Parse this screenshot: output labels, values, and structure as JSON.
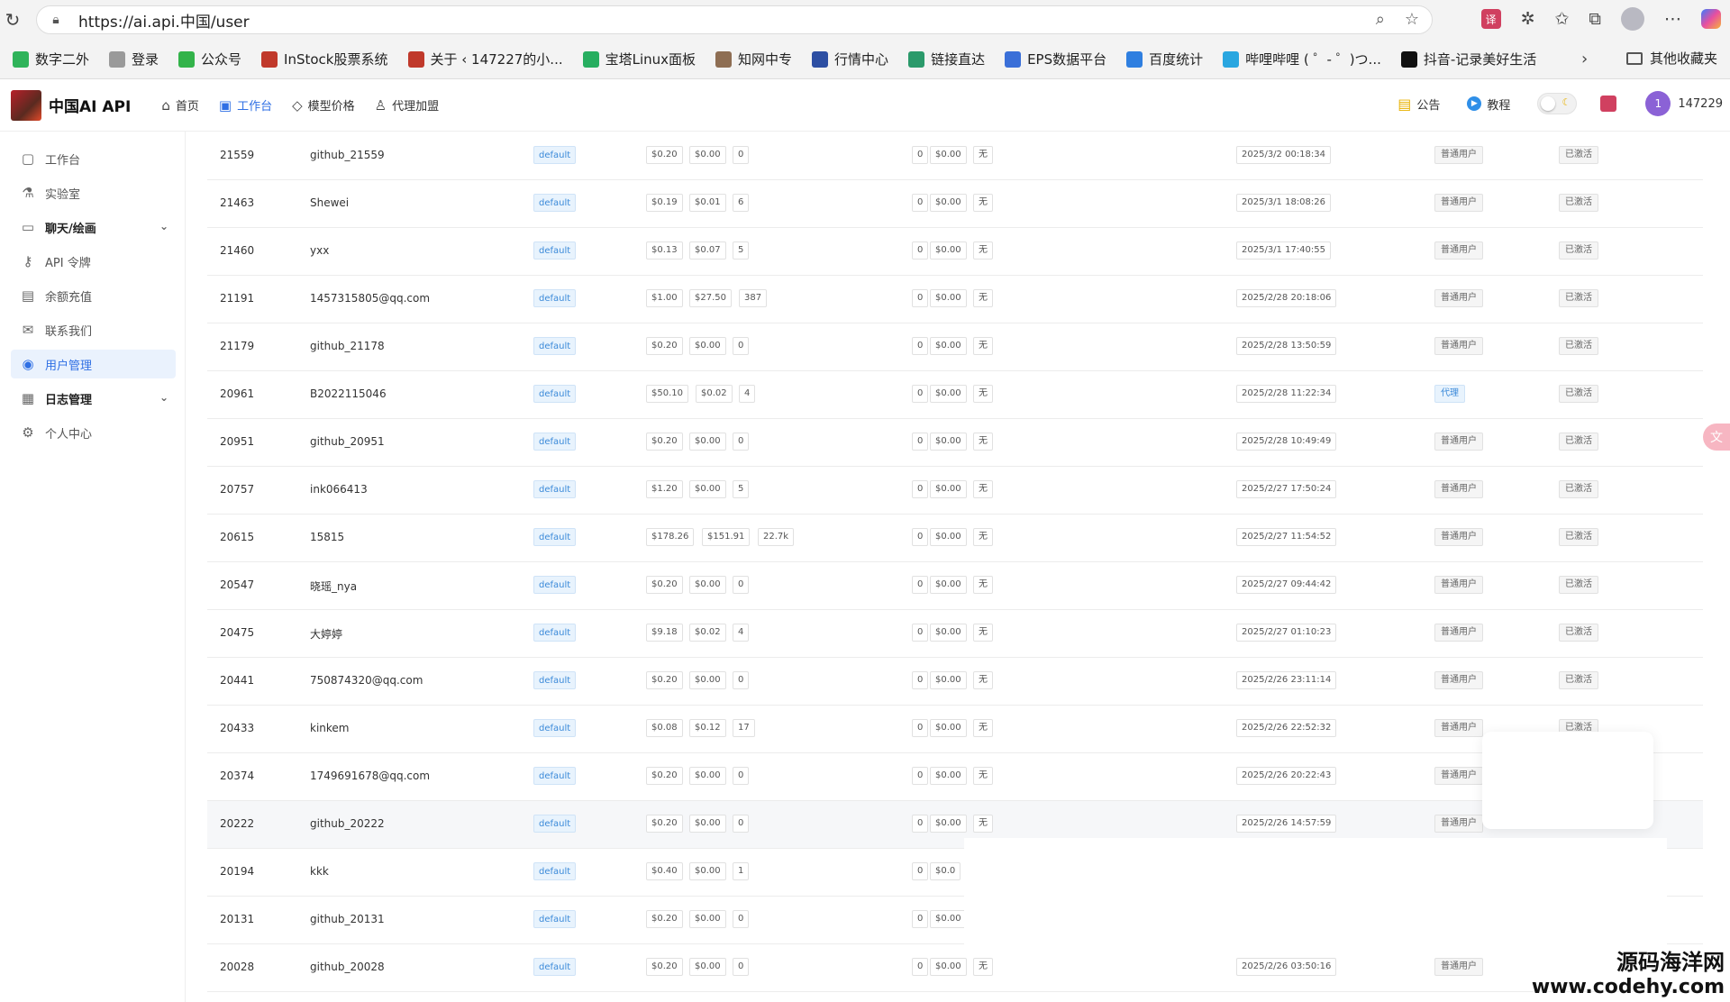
{
  "browser": {
    "url": "https://ai.api.中国/user",
    "bookmarks": [
      {
        "label": "数字二外",
        "color": "#2fb35a"
      },
      {
        "label": "登录",
        "color": "#9a9a9a"
      },
      {
        "label": "公众号",
        "color": "#33b34a"
      },
      {
        "label": "InStock股票系统",
        "color": "#c0392b"
      },
      {
        "label": "关于 ‹ 147227的小...",
        "color": "#c0392b"
      },
      {
        "label": "宝塔Linux面板",
        "color": "#27ae60"
      },
      {
        "label": "知网中专",
        "color": "#8e6e53"
      },
      {
        "label": "行情中心",
        "color": "#2d4fa3"
      },
      {
        "label": "链接直达",
        "color": "#2b9a6b"
      },
      {
        "label": "EPS数据平台",
        "color": "#3a6fd8"
      },
      {
        "label": "百度统计",
        "color": "#2f7fe0"
      },
      {
        "label": "哔哩哔哩 ( ゜- ゜)つ...",
        "color": "#29a6e0"
      },
      {
        "label": "抖音-记录美好生活",
        "color": "#111111"
      }
    ],
    "other_bookmarks": "其他收藏夹"
  },
  "header": {
    "brand": "中国AI API",
    "nav": [
      {
        "label": "首页",
        "icon": "home-icon"
      },
      {
        "label": "工作台",
        "icon": "workbench-icon",
        "active": true
      },
      {
        "label": "模型价格",
        "icon": "tag-icon"
      },
      {
        "label": "代理加盟",
        "icon": "agent-icon"
      }
    ],
    "announcement": "公告",
    "tutorial": "教程",
    "avatar_letter": "1",
    "username": "147229"
  },
  "sidebar": {
    "items": [
      {
        "label": "工作台",
        "icon": "chat-icon"
      },
      {
        "label": "实验室",
        "icon": "flask-icon"
      },
      {
        "label": "聊天/绘画",
        "icon": "message-icon",
        "bold": true,
        "chevron": true
      },
      {
        "label": "API 令牌",
        "icon": "key-icon"
      },
      {
        "label": "余额充值",
        "icon": "wallet-icon"
      },
      {
        "label": "联系我们",
        "icon": "mail-icon"
      },
      {
        "label": "用户管理",
        "icon": "user-icon",
        "active": true
      },
      {
        "label": "日志管理",
        "icon": "log-icon",
        "bold": true,
        "chevron": true
      },
      {
        "label": "个人中心",
        "icon": "gear-icon"
      }
    ]
  },
  "table": {
    "rows": [
      {
        "id": "21559",
        "name": "github_21559",
        "group": "default",
        "balance": "$0.20",
        "used": "$0.00",
        "count": "0",
        "inv": "0",
        "inv_amt": "$0.00",
        "inviter": "无",
        "date": "2025/3/2 00:18:34",
        "role": "普通用户",
        "status": "已激活"
      },
      {
        "id": "21463",
        "name": "Shewei",
        "group": "default",
        "balance": "$0.19",
        "used": "$0.01",
        "count": "6",
        "inv": "0",
        "inv_amt": "$0.00",
        "inviter": "无",
        "date": "2025/3/1 18:08:26",
        "role": "普通用户",
        "status": "已激活"
      },
      {
        "id": "21460",
        "name": "yxx",
        "group": "default",
        "balance": "$0.13",
        "used": "$0.07",
        "count": "5",
        "inv": "0",
        "inv_amt": "$0.00",
        "inviter": "无",
        "date": "2025/3/1 17:40:55",
        "role": "普通用户",
        "status": "已激活"
      },
      {
        "id": "21191",
        "name": "1457315805@qq.com",
        "group": "default",
        "balance": "$1.00",
        "used": "$27.50",
        "count": "387",
        "inv": "0",
        "inv_amt": "$0.00",
        "inviter": "无",
        "date": "2025/2/28 20:18:06",
        "role": "普通用户",
        "status": "已激活"
      },
      {
        "id": "21179",
        "name": "github_21178",
        "group": "default",
        "balance": "$0.20",
        "used": "$0.00",
        "count": "0",
        "inv": "0",
        "inv_amt": "$0.00",
        "inviter": "无",
        "date": "2025/2/28 13:50:59",
        "role": "普通用户",
        "status": "已激活"
      },
      {
        "id": "20961",
        "name": "B2022115046",
        "group": "default",
        "balance": "$50.10",
        "used": "$0.02",
        "count": "4",
        "inv": "0",
        "inv_amt": "$0.00",
        "inviter": "无",
        "date": "2025/2/28 11:22:34",
        "role": "代理",
        "status": "已激活",
        "agent": true
      },
      {
        "id": "20951",
        "name": "github_20951",
        "group": "default",
        "balance": "$0.20",
        "used": "$0.00",
        "count": "0",
        "inv": "0",
        "inv_amt": "$0.00",
        "inviter": "无",
        "date": "2025/2/28 10:49:49",
        "role": "普通用户",
        "status": "已激活"
      },
      {
        "id": "20757",
        "name": "ink066413",
        "group": "default",
        "balance": "$1.20",
        "used": "$0.00",
        "count": "5",
        "inv": "0",
        "inv_amt": "$0.00",
        "inviter": "无",
        "date": "2025/2/27 17:50:24",
        "role": "普通用户",
        "status": "已激活"
      },
      {
        "id": "20615",
        "name": "15815",
        "group": "default",
        "balance": "$178.26",
        "used": "$151.91",
        "count": "22.7k",
        "inv": "0",
        "inv_amt": "$0.00",
        "inviter": "无",
        "date": "2025/2/27 11:54:52",
        "role": "普通用户",
        "status": "已激活"
      },
      {
        "id": "20547",
        "name": "晓瑶_nya",
        "group": "default",
        "balance": "$0.20",
        "used": "$0.00",
        "count": "0",
        "inv": "0",
        "inv_amt": "$0.00",
        "inviter": "无",
        "date": "2025/2/27 09:44:42",
        "role": "普通用户",
        "status": "已激活"
      },
      {
        "id": "20475",
        "name": "大婷婷",
        "group": "default",
        "balance": "$9.18",
        "used": "$0.02",
        "count": "4",
        "inv": "0",
        "inv_amt": "$0.00",
        "inviter": "无",
        "date": "2025/2/27 01:10:23",
        "role": "普通用户",
        "status": "已激活"
      },
      {
        "id": "20441",
        "name": "750874320@qq.com",
        "group": "default",
        "balance": "$0.20",
        "used": "$0.00",
        "count": "0",
        "inv": "0",
        "inv_amt": "$0.00",
        "inviter": "无",
        "date": "2025/2/26 23:11:14",
        "role": "普通用户",
        "status": "已激活"
      },
      {
        "id": "20433",
        "name": "kinkem",
        "group": "default",
        "balance": "$0.08",
        "used": "$0.12",
        "count": "17",
        "inv": "0",
        "inv_amt": "$0.00",
        "inviter": "无",
        "date": "2025/2/26 22:52:32",
        "role": "普通用户",
        "status": "已激活"
      },
      {
        "id": "20374",
        "name": "1749691678@qq.com",
        "group": "default",
        "balance": "$0.20",
        "used": "$0.00",
        "count": "0",
        "inv": "0",
        "inv_amt": "$0.00",
        "inviter": "无",
        "date": "2025/2/26 20:22:43",
        "role": "普通用户",
        "status": ""
      },
      {
        "id": "20222",
        "name": "github_20222",
        "group": "default",
        "balance": "$0.20",
        "used": "$0.00",
        "count": "0",
        "inv": "0",
        "inv_amt": "$0.00",
        "inviter": "无",
        "date": "2025/2/26 14:57:59",
        "role": "普通用户",
        "status": "",
        "hl": true
      },
      {
        "id": "20194",
        "name": "kkk",
        "group": "default",
        "balance": "$0.40",
        "used": "$0.00",
        "count": "1",
        "inv": "0",
        "inv_amt": "$0.0",
        "inviter": "",
        "date": "",
        "role": "",
        "status": ""
      },
      {
        "id": "20131",
        "name": "github_20131",
        "group": "default",
        "balance": "$0.20",
        "used": "$0.00",
        "count": "0",
        "inv": "0",
        "inv_amt": "$0.00",
        "inviter": "",
        "date": "",
        "role": "",
        "status": ""
      },
      {
        "id": "20028",
        "name": "github_20028",
        "group": "default",
        "balance": "$0.20",
        "used": "$0.00",
        "count": "0",
        "inv": "0",
        "inv_amt": "$0.00",
        "inviter": "无",
        "date": "2025/2/26 03:50:16",
        "role": "普通用户",
        "status": ""
      }
    ]
  },
  "watermark": {
    "line1": "源码海洋网",
    "line2": "www.codehy.com"
  }
}
